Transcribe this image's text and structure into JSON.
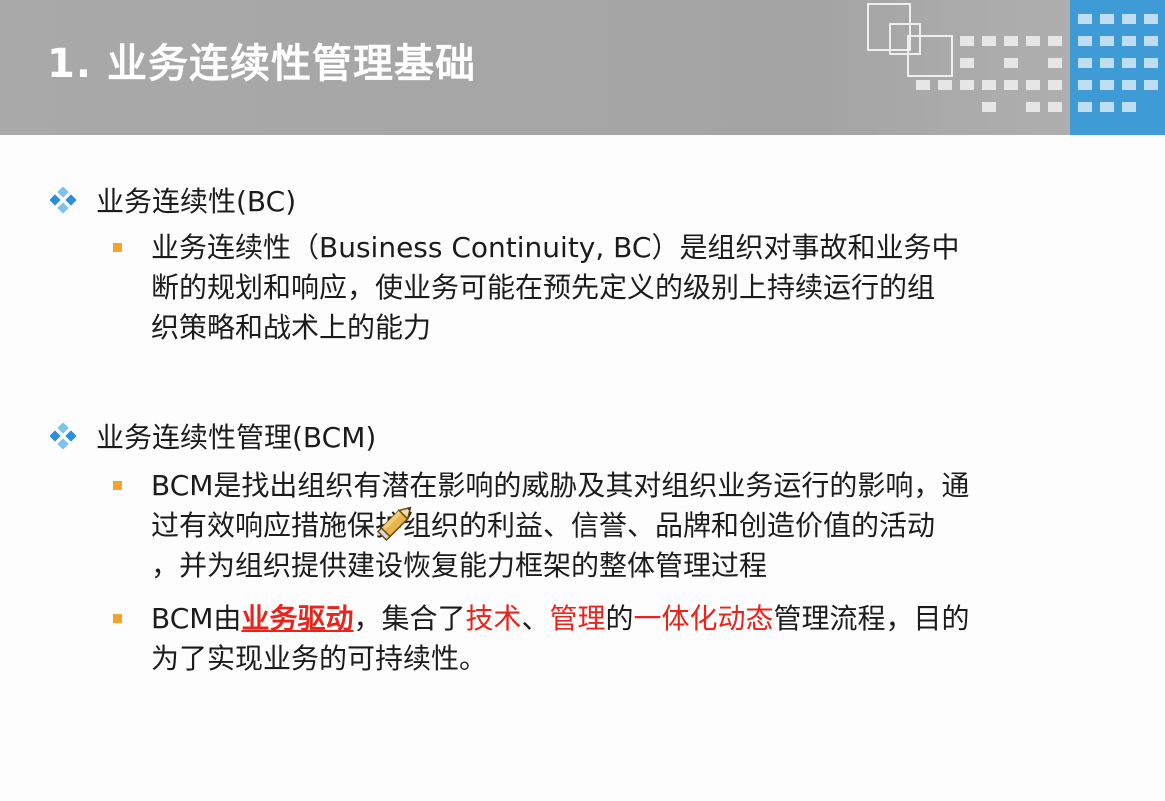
{
  "header": {
    "title": "1. 业务连续性管理基础"
  },
  "sections": [
    {
      "heading": "业务连续性(BC)",
      "items": [
        {
          "line1": "业务连续性（Business Continuity, BC）是组织对事故和业务中",
          "line2": "断的规划和响应，使业务可能在预先定义的级别上持续运行的组",
          "line3": "织策略和战术上的能力"
        }
      ]
    },
    {
      "heading": "业务连续性管理(BCM)",
      "items": [
        {
          "line1": "BCM是找出组织有潜在影响的威胁及其对组织业务运行的影响，通",
          "line2": "过有效响应措施保护组织的利益、信誉、品牌和创造价值的活动",
          "line3": "，并为组织提供建设恢复能力框架的整体管理过程"
        },
        {
          "p1": "BCM由",
          "r1": "业务驱动",
          "p2": "，集合了",
          "r2": "技术",
          "p3": "、",
          "r3": "管理",
          "p4": "的",
          "r4": "一体化动态",
          "p5": "管理流程，目的",
          "line2": "为了实现业务的可持续性。"
        }
      ]
    }
  ],
  "colors": {
    "header_bg": "#a9a9a9",
    "title_text": "#ffffff",
    "diamond": "#2e8fd9",
    "bullet": "#f1a52c",
    "emphasis_red": "#e8241c",
    "body_text": "#1c1c1c"
  },
  "icons": [
    "diamond-bullet-icon",
    "square-bullet-icon",
    "pencil-cursor-icon"
  ]
}
